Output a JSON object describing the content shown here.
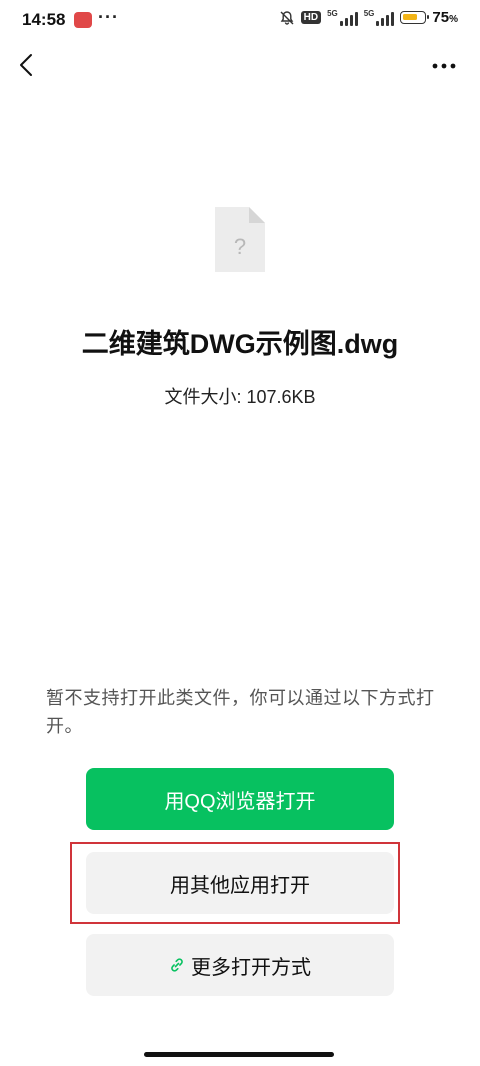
{
  "status_bar": {
    "time": "14:58",
    "dots": "···",
    "hd": "HD",
    "net1": "5G",
    "net2": "5G",
    "battery_level": 0.75,
    "battery_text": "75",
    "battery_pct_sign": "%",
    "battery_color": "#f2b416"
  },
  "header": {
    "back_icon": "chevron-left-icon",
    "more_icon": "more-horizontal-icon"
  },
  "file": {
    "icon": "unknown-file-icon",
    "name": "二维建筑DWG示例图.dwg",
    "size_label": "文件大小:",
    "size_value": "107.6KB"
  },
  "hint": {
    "text": "暂不支持打开此类文件，你可以通过以下方式打开。"
  },
  "actions": {
    "open_qq_browser": "用QQ浏览器打开",
    "open_other_app": "用其他应用打开",
    "more_ways": "更多打开方式",
    "more_ways_icon": "link-icon"
  },
  "colors": {
    "primary": "#07c160",
    "highlight": "#d0343a"
  }
}
